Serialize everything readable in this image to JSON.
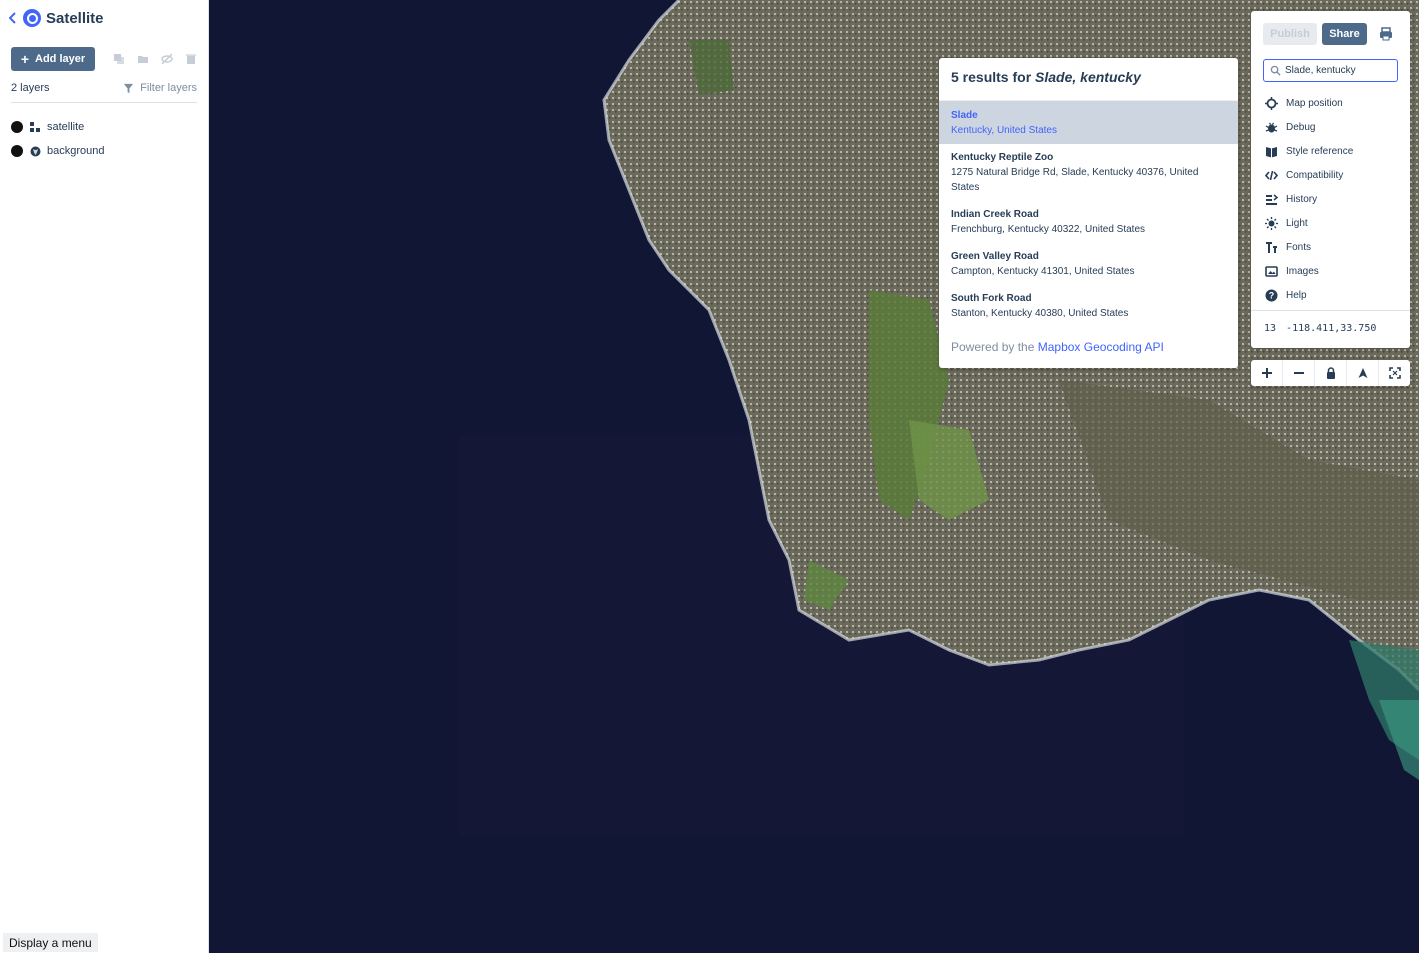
{
  "sidebar": {
    "title": "Satellite",
    "add_layer_label": "Add layer",
    "layer_count": "2 layers",
    "filter_label": "Filter layers",
    "layers": [
      {
        "name": "satellite",
        "icon": "raster-layer-icon"
      },
      {
        "name": "background",
        "icon": "background-layer-icon"
      }
    ],
    "display_menu_label": "Display a menu"
  },
  "results": {
    "heading_prefix": "5 results for",
    "heading_query": "Slade, kentucky",
    "items": [
      {
        "name": "Slade",
        "address": "Kentucky, United States",
        "active": true
      },
      {
        "name": "Kentucky Reptile Zoo",
        "address": "1275 Natural Bridge Rd, Slade, Kentucky 40376, United States"
      },
      {
        "name": "Indian Creek Road",
        "address": "Frenchburg, Kentucky 40322, United States"
      },
      {
        "name": "Green Valley Road",
        "address": "Campton, Kentucky 41301, United States"
      },
      {
        "name": "South Fork Road",
        "address": "Stanton, Kentucky 40380, United States"
      }
    ],
    "powered_prefix": "Powered by the",
    "powered_link": "Mapbox Geocoding API"
  },
  "panel": {
    "publish_label": "Publish",
    "share_label": "Share",
    "search_value": "Slade, kentucky",
    "menu": [
      {
        "label": "Map position",
        "icon": "crosshair-icon"
      },
      {
        "label": "Debug",
        "icon": "bug-icon"
      },
      {
        "label": "Style reference",
        "icon": "book-icon"
      },
      {
        "label": "Compatibility",
        "icon": "code-icon"
      },
      {
        "label": "History",
        "icon": "history-icon"
      },
      {
        "label": "Light",
        "icon": "light-icon"
      },
      {
        "label": "Fonts",
        "icon": "fonts-icon"
      },
      {
        "label": "Images",
        "icon": "images-icon"
      },
      {
        "label": "Help",
        "icon": "help-icon"
      }
    ],
    "zoom": "13",
    "coordinates": "-118.411,33.750"
  },
  "colors": {
    "accent": "#4264fb",
    "button": "#4d6a8a",
    "ocean": "#101634"
  }
}
